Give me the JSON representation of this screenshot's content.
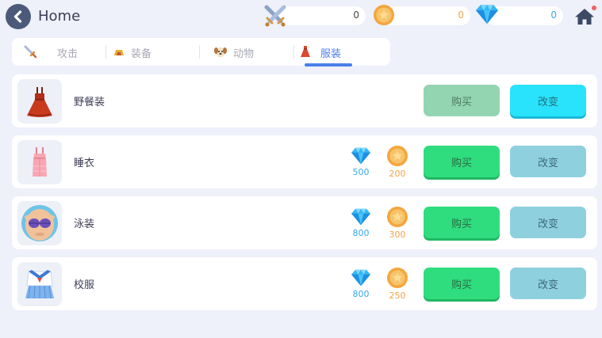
{
  "header": {
    "title": "Home",
    "back_icon": "chevron-left-icon",
    "home_icon": "home-icon",
    "currencies": {
      "swords": {
        "icon": "crossed-swords-icon",
        "value": "0"
      },
      "coins": {
        "icon": "coin-icon",
        "value": "0"
      },
      "gems": {
        "icon": "diamond-icon",
        "value": "0"
      }
    }
  },
  "tabs": [
    {
      "label": "攻击",
      "icon": "sword-icon",
      "active": false
    },
    {
      "label": "装备",
      "icon": "helmet-icon",
      "active": false
    },
    {
      "label": "动物",
      "icon": "dog-icon",
      "active": false
    },
    {
      "label": "服装",
      "icon": "dress-icon",
      "active": true
    }
  ],
  "items": [
    {
      "name": "野餐装",
      "icon": "picnic-dress-icon",
      "buy_label": "购买",
      "change_label": "改变",
      "buy_enabled": false,
      "change_active": true
    },
    {
      "name": "睡衣",
      "icon": "pajamas-icon",
      "gem_price": "500",
      "coin_price": "200",
      "buy_label": "购买",
      "change_label": "改变",
      "buy_enabled": true,
      "change_active": false
    },
    {
      "name": "泳装",
      "icon": "swimsuit-icon",
      "gem_price": "800",
      "coin_price": "300",
      "buy_label": "购买",
      "change_label": "改变",
      "buy_enabled": true,
      "change_active": false
    },
    {
      "name": "校服",
      "icon": "school-uniform-icon",
      "gem_price": "800",
      "coin_price": "250",
      "buy_label": "购买",
      "change_label": "改变",
      "buy_enabled": true,
      "change_active": false
    }
  ],
  "colors": {
    "background": "#eef0fa",
    "accent": "#4a7fe8",
    "buy_green": "#2fdc7e",
    "change_cyan": "#29e2fb",
    "gem_blue": "#38a9e8",
    "coin_orange": "#f3a44a"
  }
}
